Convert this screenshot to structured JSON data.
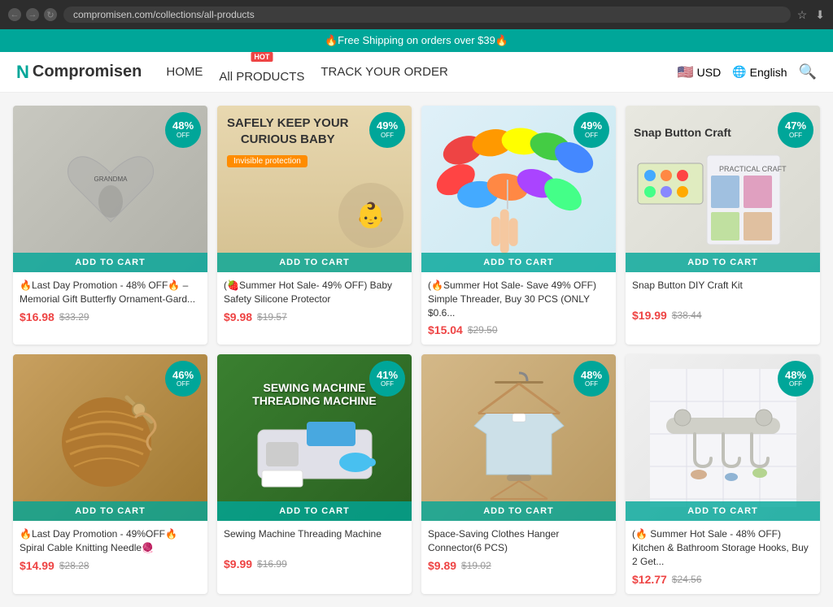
{
  "browser": {
    "url": "compromisen.com/collections/all-products",
    "back_icon": "←",
    "forward_icon": "→",
    "refresh_icon": "↻",
    "star_icon": "☆",
    "download_icon": "↓"
  },
  "announcement": {
    "text": "🔥Free Shipping on orders over $39🔥"
  },
  "nav": {
    "logo_text": "Compromisen",
    "links": [
      {
        "label": "HOME",
        "hot": false
      },
      {
        "label": "All PRODUCTS",
        "hot": true
      },
      {
        "label": "TRACK YOUR ORDER",
        "hot": false
      }
    ],
    "currency": "USD",
    "language": "English",
    "hot_label": "HOT"
  },
  "products": [
    {
      "id": 0,
      "discount": "48%",
      "off_label": "OFF",
      "title": "🔥Last Day Promotion - 48% OFF🔥 - Memorial Gift Butterfly Ornament-Gard...",
      "sale_price": "$16.98",
      "original_price": "$33.29",
      "add_to_cart": "ADD TO CART",
      "bg_color": "#d8d8d8",
      "image_desc": "butterfly memorial ornament"
    },
    {
      "id": 1,
      "discount": "49%",
      "off_label": "OFF",
      "title": "(🍓Summer Hot Sale- 49% OFF) Baby Safety Silicone Protector",
      "sale_price": "$9.98",
      "original_price": "$19.57",
      "add_to_cart": "ADD TO CART",
      "bg_color": "#f5e0c0",
      "image_desc": "baby safety protector"
    },
    {
      "id": 2,
      "discount": "49%",
      "off_label": "OFF",
      "title": "(🔥Summer Hot Sale- Save 49% OFF) Simple Threader, Buy 30 PCS (ONLY $0.6...",
      "sale_price": "$15.04",
      "original_price": "$29.50",
      "add_to_cart": "ADD TO CART",
      "bg_color": "#e0f5ff",
      "image_desc": "colorful threaders"
    },
    {
      "id": 3,
      "discount": "47%",
      "off_label": "OFF",
      "title": "Snap Button DIY Craft Kit",
      "sale_price": "$19.99",
      "original_price": "$38.44",
      "add_to_cart": "ADD TO CART",
      "bg_color": "#f0f0e8",
      "image_desc": "snap button craft kit"
    },
    {
      "id": 4,
      "discount": "46%",
      "off_label": "OFF",
      "title": "🔥Last Day Promotion - 49%OFF🔥Spiral Cable Knitting Needle🧶",
      "sale_price": "$14.99",
      "original_price": "$28.28",
      "add_to_cart": "ADD TO CART",
      "bg_color": "#b08040",
      "image_desc": "spiral knitting needle"
    },
    {
      "id": 5,
      "discount": "41%",
      "off_label": "OFF",
      "title": "Sewing Machine Threading Machine",
      "sale_price": "$9.99",
      "original_price": "$16.99",
      "add_to_cart": "ADD TO CART",
      "bg_color": "#5a9a30",
      "image_desc": "sewing machine threader"
    },
    {
      "id": 6,
      "discount": "48%",
      "off_label": "OFF",
      "title": "Space-Saving Clothes Hanger Connector(6 PCS)",
      "sale_price": "$9.89",
      "original_price": "$19.02",
      "add_to_cart": "ADD TO CART",
      "bg_color": "#c8a878",
      "image_desc": "clothes hanger connectors"
    },
    {
      "id": 7,
      "discount": "48%",
      "off_label": "OFF",
      "title": "(🔥 Summer Hot Sale - 48% OFF) Kitchen & Bathroom Storage Hooks, Buy 2 Get...",
      "sale_price": "$12.77",
      "original_price": "$24.56",
      "add_to_cart": "ADD TO CART",
      "bg_color": "#f0f0f0",
      "image_desc": "bathroom storage hooks"
    }
  ]
}
